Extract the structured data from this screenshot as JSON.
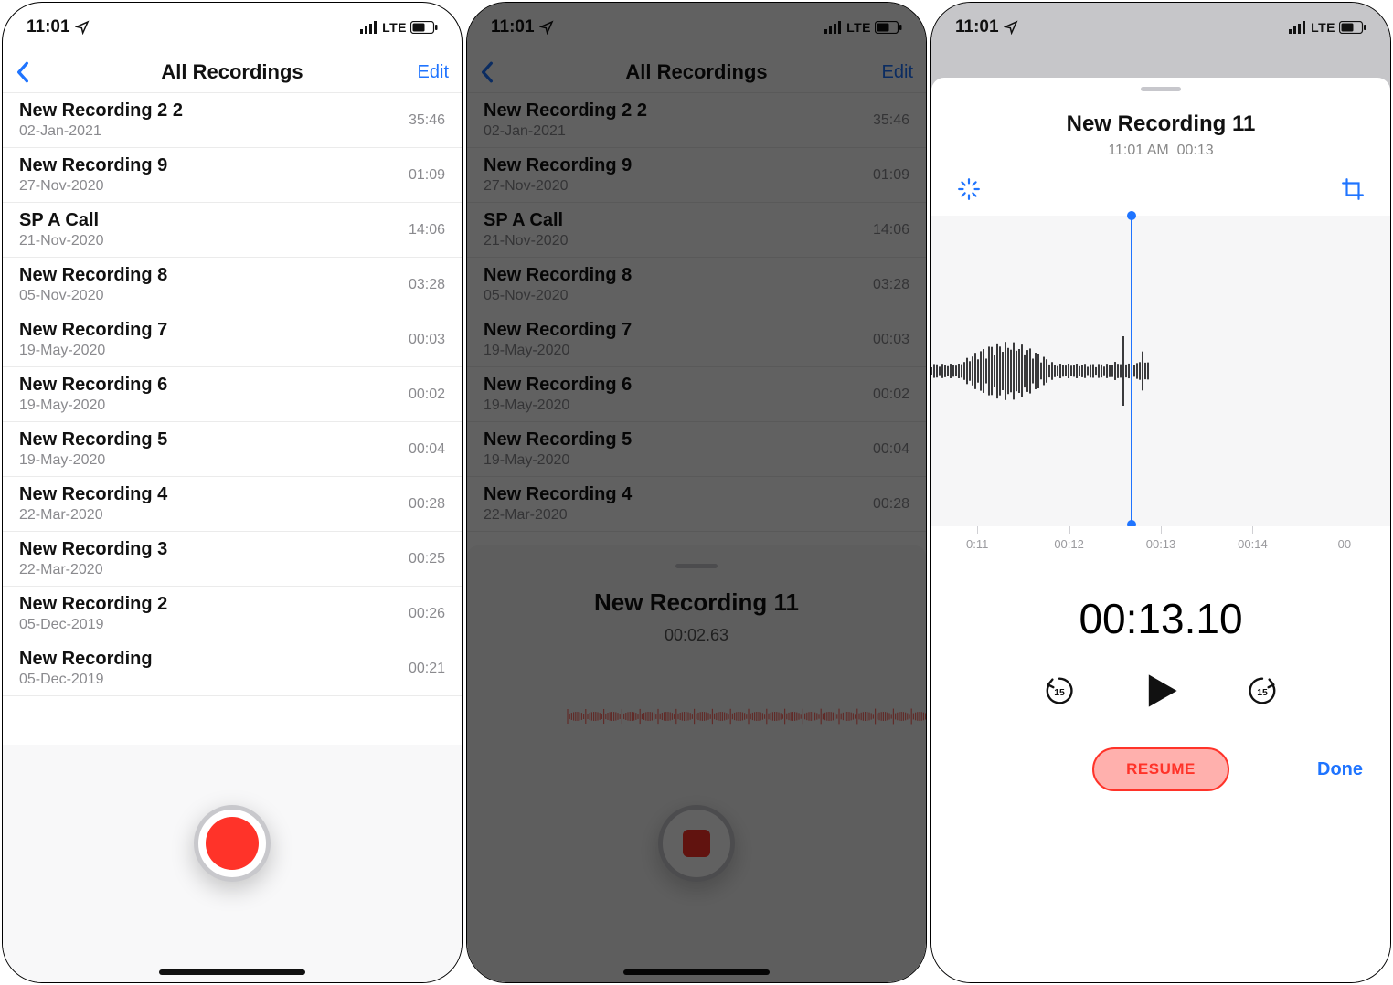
{
  "status": {
    "time": "11:01",
    "net": "LTE"
  },
  "nav": {
    "title": "All Recordings",
    "edit": "Edit"
  },
  "recordings": [
    {
      "title": "New Recording 2 2",
      "date": "02-Jan-2021",
      "dur": "35:46"
    },
    {
      "title": "New Recording 9",
      "date": "27-Nov-2020",
      "dur": "01:09"
    },
    {
      "title": "SP A Call",
      "date": "21-Nov-2020",
      "dur": "14:06"
    },
    {
      "title": "New Recording 8",
      "date": "05-Nov-2020",
      "dur": "03:28"
    },
    {
      "title": "New Recording 7",
      "date": "19-May-2020",
      "dur": "00:03"
    },
    {
      "title": "New Recording 6",
      "date": "19-May-2020",
      "dur": "00:02"
    },
    {
      "title": "New Recording 5",
      "date": "19-May-2020",
      "dur": "00:04"
    },
    {
      "title": "New Recording 4",
      "date": "22-Mar-2020",
      "dur": "00:28"
    },
    {
      "title": "New Recording 3",
      "date": "22-Mar-2020",
      "dur": "00:25"
    },
    {
      "title": "New Recording 2",
      "date": "05-Dec-2019",
      "dur": "00:26"
    },
    {
      "title": "New Recording",
      "date": "05-Dec-2019",
      "dur": "00:21"
    }
  ],
  "sheet": {
    "title": "New Recording 11",
    "elapsed": "00:02.63"
  },
  "editor": {
    "title": "New Recording 11",
    "time_label": "11:01 AM",
    "duration": "00:13",
    "big_time": "00:13.10",
    "ticks": [
      "0:11",
      "00:12",
      "00:13",
      "00:14",
      "00"
    ],
    "resume": "RESUME",
    "done": "Done"
  }
}
